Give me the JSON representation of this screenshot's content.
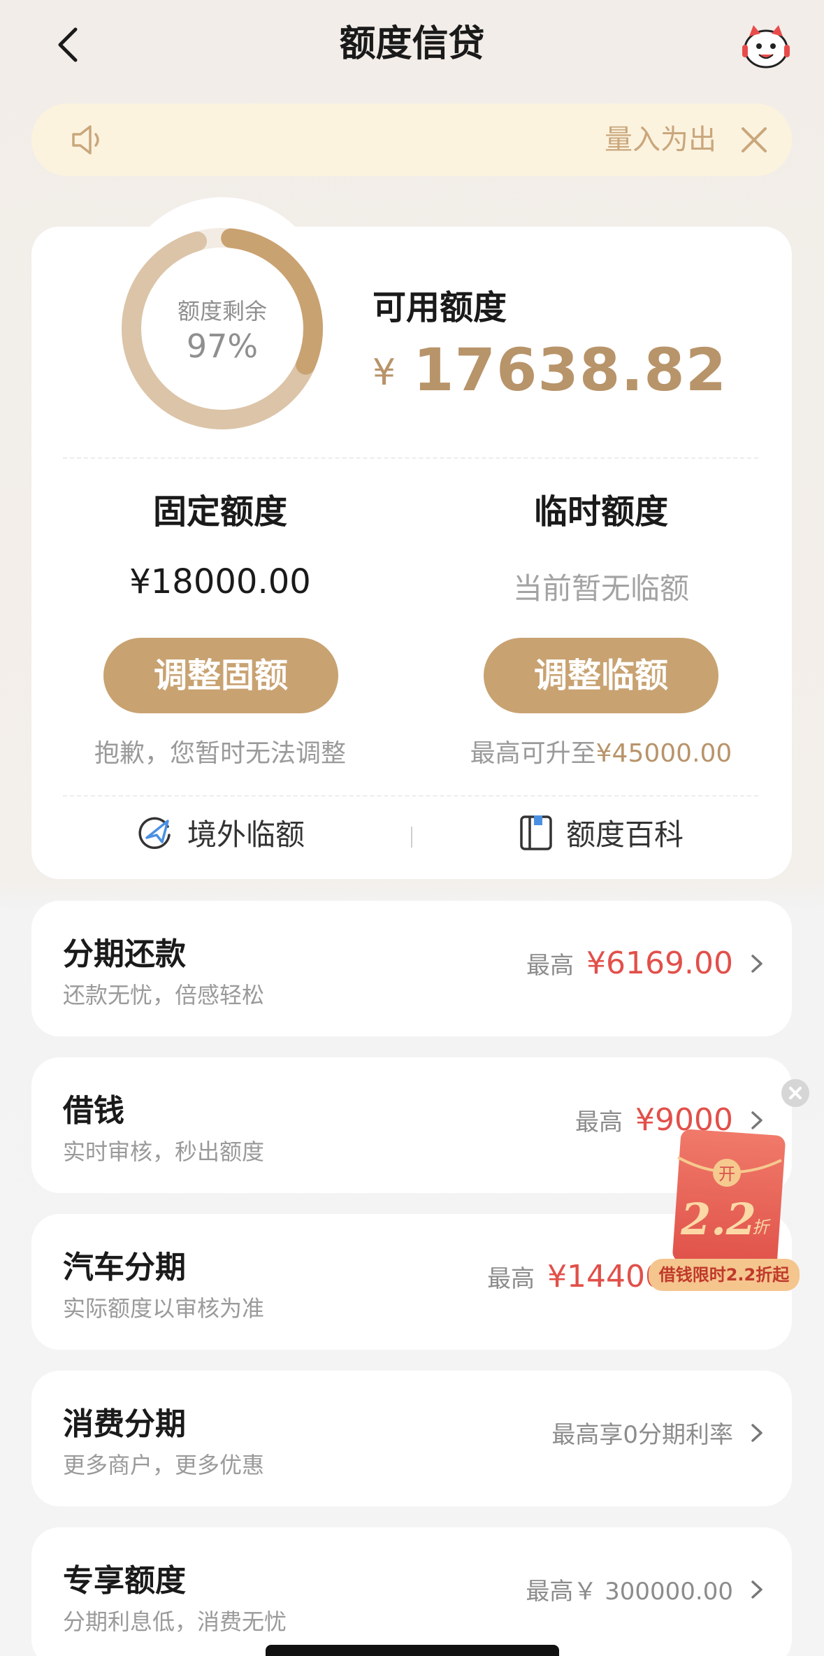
{
  "header": {
    "title": "额度信贷"
  },
  "notice": {
    "text": "量入为出"
  },
  "credit": {
    "ring_label": "额度剩余",
    "ring_percent": "97%",
    "ring_fraction": 0.97,
    "available_label": "可用额度",
    "available_currency": "¥",
    "available_amount": "17638.82"
  },
  "fixed": {
    "title": "固定额度",
    "value": "¥18000.00",
    "button": "调整固额",
    "note": "抱歉，您暂时无法调整"
  },
  "temp": {
    "title": "临时额度",
    "value": "当前暂无临额",
    "button": "调整临额",
    "note_prefix": "最高可升至",
    "note_amount": "¥45000.00"
  },
  "links": {
    "overseas": "境外临额",
    "wiki": "额度百科"
  },
  "list": [
    {
      "title": "分期还款",
      "subtitle": "还款无忧，倍感轻松",
      "prefix": "最高",
      "amount": "¥6169.00"
    },
    {
      "title": "借钱",
      "subtitle": "实时审核，秒出额度",
      "prefix": "最高",
      "amount": "¥9000"
    },
    {
      "title": "汽车分期",
      "subtitle": "实际额度以审核为准",
      "prefix": "最高",
      "amount": "¥144000.00"
    },
    {
      "title": "消费分期",
      "subtitle": "更多商户，更多优惠",
      "right_text": "最高享0分期利率"
    },
    {
      "title": "专享额度",
      "subtitle": "分期利息低，消费无忧",
      "right_text": "最高￥ 300000.00"
    }
  ],
  "promo": {
    "open_char": "开",
    "discount": "2.2",
    "discount_unit": "折",
    "tag": "借钱限时2.2折起"
  },
  "colors": {
    "gold": "#c8a271",
    "gold_text": "#b8946a",
    "red": "#e2504a",
    "notice_bg": "#fcf3df"
  }
}
